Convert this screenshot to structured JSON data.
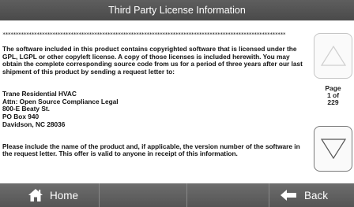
{
  "window": {
    "title": "Third Party License Information"
  },
  "license": {
    "stars": "************************************************************************************************************",
    "para1": "The software included in this product contains copyrighted software that is licensed under the GPL, LGPL or other copyleft license. A copy of those licenses is included herewith. You may obtain the complete corresponding source code from us for a period of three years after our last shipment of this product by sending a request letter to:",
    "address": "Trane Residential HVAC\nAttn: Open Source Compliance Legal\n800-E Beaty St.\nPO Box 940\nDavidson, NC 28036",
    "para3": "Please include the name of the product and, if applicable, the version number of the software in the request letter. This offer is valid to anyone in receipt of this information."
  },
  "pager": {
    "page_label": "Page",
    "page_of": "1 of",
    "page_total": "229"
  },
  "nav": {
    "home_label": "Home",
    "back_label": "Back",
    "home_icon": "house-icon",
    "back_icon": "arrow-left-icon"
  },
  "colors": {
    "title_bar": "#4f4f4f",
    "bottom_bar": "#5f5f5f",
    "content_bg": "#ffffff"
  }
}
